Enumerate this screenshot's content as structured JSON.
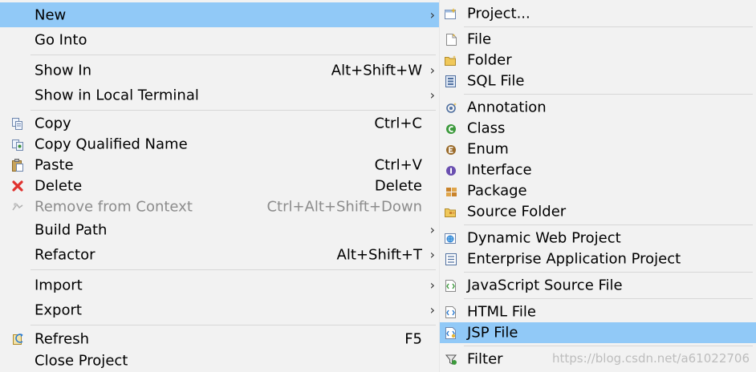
{
  "main_menu": [
    {
      "label": "New",
      "shortcut": "",
      "arrow": "›",
      "icon": "none"
    },
    {
      "label": "Go Into",
      "shortcut": "",
      "arrow": "",
      "icon": "none"
    },
    {
      "label": "Show In",
      "shortcut": "Alt+Shift+W",
      "arrow": "›",
      "icon": "none"
    },
    {
      "label": "Show in Local Terminal",
      "shortcut": "",
      "arrow": "›",
      "icon": "none"
    },
    {
      "label": "Copy",
      "shortcut": "Ctrl+C",
      "arrow": "",
      "icon": "copy-icon"
    },
    {
      "label": "Copy Qualified Name",
      "shortcut": "",
      "arrow": "",
      "icon": "copy-qualified-name-icon"
    },
    {
      "label": "Paste",
      "shortcut": "Ctrl+V",
      "arrow": "",
      "icon": "paste-icon"
    },
    {
      "label": "Delete",
      "shortcut": "Delete",
      "arrow": "",
      "icon": "delete-icon"
    },
    {
      "label": "Remove from Context",
      "shortcut": "Ctrl+Alt+Shift+Down",
      "arrow": "",
      "icon": "remove-from-context-icon",
      "disabled": true
    },
    {
      "label": "Build Path",
      "shortcut": "",
      "arrow": "›",
      "icon": "none"
    },
    {
      "label": "Refactor",
      "shortcut": "Alt+Shift+T",
      "arrow": "›",
      "icon": "none"
    },
    {
      "label": "Import",
      "shortcut": "",
      "arrow": "›",
      "icon": "none"
    },
    {
      "label": "Export",
      "shortcut": "",
      "arrow": "›",
      "icon": "none"
    },
    {
      "label": "Refresh",
      "shortcut": "F5",
      "arrow": "",
      "icon": "refresh-icon"
    },
    {
      "label": "Close Project",
      "shortcut": "",
      "arrow": "",
      "icon": "none"
    }
  ],
  "main_highlighted": "New",
  "sub_menu": [
    {
      "label": "Project...",
      "icon": "project-icon"
    },
    {
      "label": "File",
      "icon": "file-icon"
    },
    {
      "label": "Folder",
      "icon": "folder-icon"
    },
    {
      "label": "SQL File",
      "icon": "sql-file-icon"
    },
    {
      "label": "Annotation",
      "icon": "annotation-icon"
    },
    {
      "label": "Class",
      "icon": "class-icon"
    },
    {
      "label": "Enum",
      "icon": "enum-icon"
    },
    {
      "label": "Interface",
      "icon": "interface-icon"
    },
    {
      "label": "Package",
      "icon": "package-icon"
    },
    {
      "label": "Source Folder",
      "icon": "source-folder-icon"
    },
    {
      "label": "Dynamic Web Project",
      "icon": "dynamic-web-project-icon"
    },
    {
      "label": "Enterprise Application Project",
      "icon": "enterprise-application-project-icon"
    },
    {
      "label": "JavaScript Source File",
      "icon": "javascript-source-file-icon"
    },
    {
      "label": "HTML File",
      "icon": "html-file-icon"
    },
    {
      "label": "JSP File",
      "icon": "jsp-file-icon"
    },
    {
      "label": "Filter",
      "icon": "filter-icon"
    }
  ],
  "sub_highlighted": "JSP File",
  "watermark": "https://blog.csdn.net/a61022706",
  "colors": {
    "menu_bg": "#f2f2f2",
    "highlight": "#91c9f7",
    "separator": "#d7d7d7",
    "disabled_text": "#8c8c8c"
  }
}
